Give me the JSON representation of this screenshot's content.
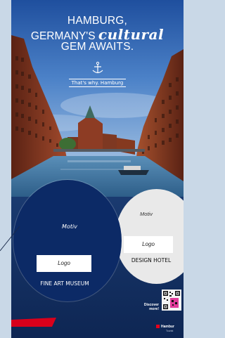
{
  "headline": {
    "line1": "HAMBURG,",
    "line2_prefix": "GERMANY'S",
    "line2_script": "cultural",
    "line3": "GEM AWAITS."
  },
  "tagline": "That's why. Hamburg",
  "icons": [
    "anchor-icon",
    "qr-code-icon",
    "hamburg-logo-mark"
  ],
  "left_circle": {
    "motiv": "Motiv",
    "logo": "Logo",
    "name": "FINE ART MUSEUM"
  },
  "right_circle": {
    "motiv": "Motiv",
    "logo": "Logo",
    "name": "DESIGN HOTEL"
  },
  "discover": "Discover more!",
  "brand": "Hambur",
  "brand_sub": "Tourist",
  "colors": {
    "navy": "#0c2a66",
    "sky": "#2f5fb0",
    "brick": "#8c3a22",
    "water": "#2a6f9c",
    "accent_red": "#e8001c",
    "light_circle": "#e9e9e9",
    "qr_pink": "#e23a9a"
  }
}
